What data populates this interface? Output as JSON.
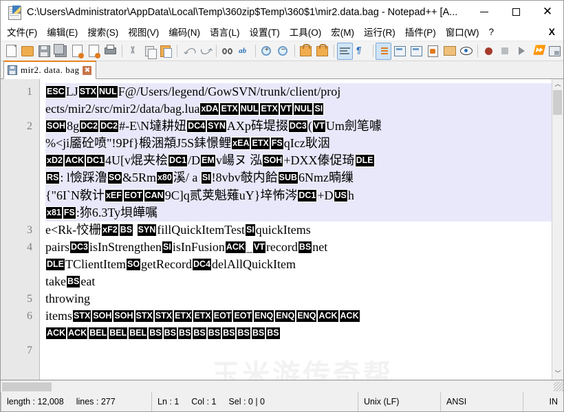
{
  "window": {
    "title": "C:\\Users\\Administrator\\AppData\\Local\\Temp\\360zip$Temp\\360$1\\mir2.data.bag - Notepad++ [A...",
    "minimize": "—",
    "maximize": "❐",
    "close": "✕"
  },
  "menu": {
    "items": [
      {
        "label": "文件(F)"
      },
      {
        "label": "编辑(E)"
      },
      {
        "label": "搜索(S)"
      },
      {
        "label": "视图(V)"
      },
      {
        "label": "编码(N)"
      },
      {
        "label": "语言(L)"
      },
      {
        "label": "设置(T)"
      },
      {
        "label": "工具(O)"
      },
      {
        "label": "宏(M)"
      },
      {
        "label": "运行(R)"
      },
      {
        "label": "插件(P)"
      },
      {
        "label": "窗口(W)"
      },
      {
        "label": "?"
      }
    ],
    "doc_close": "X"
  },
  "toolbar": {
    "buttons": [
      "new-file-icon",
      "open-file-icon",
      "save-icon",
      "save-all-icon",
      "close-file-icon",
      "close-all-files-icon",
      "print-icon",
      "cut-icon",
      "copy-icon",
      "paste-icon",
      "undo-icon",
      "redo-icon",
      "find-icon",
      "replace-icon",
      "zoom-in-icon",
      "zoom-out-icon",
      "sync-vertical-scroll-icon",
      "sync-horizontal-scroll-icon",
      "word-wrap-icon",
      "show-all-characters-icon",
      "indent-guide-icon",
      "ui-user-defined-dialog-icon",
      "show-document-map-icon",
      "function-list-icon",
      "folder-as-workspace-icon",
      "monitoring-icon",
      "start-recording-icon",
      "stop-recording-icon",
      "play-macro-icon",
      "run-macro-multiple-icon",
      "save-macro-icon"
    ]
  },
  "tab": {
    "label": "mir2. data. bag",
    "close": "✖",
    "icon": "saved-disk-icon"
  },
  "editor": {
    "watermark": "玉米游传奇帮",
    "lines": [
      {
        "number": "1",
        "highlighted": true,
        "rows": [
          [
            {
              "t": "c",
              "v": "ESC"
            },
            {
              "t": "p",
              "v": "LJ"
            },
            {
              "t": "c",
              "v": "STX"
            },
            {
              "t": "c",
              "v": "NUL"
            },
            {
              "t": "p",
              "v": "F@/Users/legend/GowSVN/trunk/client/proj"
            }
          ],
          [
            {
              "t": "p",
              "v": "ects/mir2/src/mir2/data/bag.lua"
            },
            {
              "t": "c",
              "v": "xDA"
            },
            {
              "t": "c",
              "v": "ETX"
            },
            {
              "t": "c",
              "v": "NUL"
            },
            {
              "t": "c",
              "v": "ETX"
            },
            {
              "t": "c",
              "v": "VT"
            },
            {
              "t": "c",
              "v": "NUL"
            },
            {
              "t": "c",
              "v": "SI"
            }
          ]
        ]
      },
      {
        "number": "2",
        "highlighted": true,
        "rows": [
          [
            {
              "t": "c",
              "v": "SOH"
            },
            {
              "t": "p",
              "v": "8g"
            },
            {
              "t": "c",
              "v": "DC2"
            },
            {
              "t": "c",
              "v": "DC2"
            },
            {
              "t": "p",
              "v": "#-E\\N墶耕妞"
            },
            {
              "t": "c",
              "v": "DC4"
            },
            {
              "t": "c",
              "v": "SYN"
            },
            {
              "t": "p",
              "v": "AXp砗堤掇"
            },
            {
              "t": "c",
              "v": "DC3"
            },
            {
              "t": "p",
              "v": "("
            },
            {
              "t": "c",
              "v": "VT"
            },
            {
              "t": "p",
              "v": "Um劍笔噱"
            }
          ],
          [
            {
              "t": "p",
              "v": "%<ji靥砼喷\"!9Pf}椴涃頮J5S銇憬鲤"
            },
            {
              "t": "c",
              "v": "xEA"
            },
            {
              "t": "c",
              "v": "ETX"
            },
            {
              "t": "c",
              "v": "FS"
            },
            {
              "t": "p",
              "v": "qIcz耿洇"
            }
          ],
          [
            {
              "t": "c",
              "v": "xD2"
            },
            {
              "t": "c",
              "v": "ACK"
            },
            {
              "t": "c",
              "v": "DC1"
            },
            {
              "t": "p",
              "v": "4U[v焜夹桧"
            },
            {
              "t": "c",
              "v": "DC1"
            },
            {
              "t": "p",
              "v": "/D"
            },
            {
              "t": "c",
              "v": "EM"
            },
            {
              "t": "p",
              "v": "v崵ヌ 泓"
            },
            {
              "t": "c",
              "v": "SOH"
            },
            {
              "t": "p",
              "v": "+DXX傣促琦"
            },
            {
              "t": "c",
              "v": "DLE"
            }
          ],
          [
            {
              "t": "c",
              "v": "RS"
            },
            {
              "t": "p",
              "v": ":  l憸踩澛"
            },
            {
              "t": "c",
              "v": "SO"
            },
            {
              "t": "p",
              "v": "&5Rm"
            },
            {
              "t": "c",
              "v": "x80"
            },
            {
              "t": "p",
              "v": "溪/ a "
            },
            {
              "t": "c",
              "v": "SI"
            },
            {
              "t": "p",
              "v": "!8vbv攲内餄"
            },
            {
              "t": "c",
              "v": "SUB"
            },
            {
              "t": "p",
              "v": "6Nmz暔缫"
            }
          ],
          [
            {
              "t": "p",
              "v": "{\"6I`N敎计"
            },
            {
              "t": "c",
              "v": "xEF"
            },
            {
              "t": "c",
              "v": "EOT"
            },
            {
              "t": "c",
              "v": "CAN"
            },
            {
              "t": "p",
              "v": "9C]q贰荚魁薙uY}垶怖涔"
            },
            {
              "t": "c",
              "v": "DC1"
            },
            {
              "t": "p",
              "v": "+D"
            },
            {
              "t": "c",
              "v": "US"
            },
            {
              "t": "p",
              "v": "h"
            }
          ],
          [
            {
              "t": "c",
              "v": "x81"
            },
            {
              "t": "c",
              "v": "FS"
            },
            {
              "t": "p",
              "v": ":狝6.3Ty垻皣嘱"
            }
          ]
        ]
      },
      {
        "number": "3",
        "highlighted": false,
        "rows": [
          [
            {
              "t": "p",
              "v": "e<Rk-恔栅"
            },
            {
              "t": "c",
              "v": "xF2"
            },
            {
              "t": "c",
              "v": "BS"
            },
            {
              "t": "p",
              "v": " "
            },
            {
              "t": "c",
              "v": "SYN"
            },
            {
              "t": "p",
              "v": "fillQuickItemTest"
            },
            {
              "t": "c",
              "v": "SI"
            },
            {
              "t": "p",
              "v": "quickItems"
            }
          ]
        ]
      },
      {
        "number": "4",
        "highlighted": false,
        "rows": [
          [
            {
              "t": "p",
              "v": "pairs"
            },
            {
              "t": "c",
              "v": "DC3"
            },
            {
              "t": "p",
              "v": "isInStrengthen"
            },
            {
              "t": "c",
              "v": "SI"
            },
            {
              "t": "p",
              "v": "isInFusion"
            },
            {
              "t": "c",
              "v": "ACK"
            },
            {
              "t": "p",
              "v": "_"
            },
            {
              "t": "c",
              "v": "VT"
            },
            {
              "t": "p",
              "v": "record"
            },
            {
              "t": "c",
              "v": "BS"
            },
            {
              "t": "p",
              "v": "net"
            }
          ],
          [
            {
              "t": "c",
              "v": "DLE"
            },
            {
              "t": "p",
              "v": "TClientItem"
            },
            {
              "t": "c",
              "v": "SO"
            },
            {
              "t": "p",
              "v": "getRecord"
            },
            {
              "t": "c",
              "v": "DC4"
            },
            {
              "t": "p",
              "v": "delAllQuickItem"
            }
          ],
          [
            {
              "t": "p",
              "v": "take"
            },
            {
              "t": "c",
              "v": "BS"
            },
            {
              "t": "p",
              "v": "eat"
            }
          ]
        ]
      },
      {
        "number": "5",
        "highlighted": false,
        "rows": [
          [
            {
              "t": "p",
              "v": "throwing"
            }
          ]
        ]
      },
      {
        "number": "6",
        "highlighted": false,
        "rows": [
          [
            {
              "t": "p",
              "v": "items"
            },
            {
              "t": "c",
              "v": "STX"
            },
            {
              "t": "c",
              "v": "SOH"
            },
            {
              "t": "c",
              "v": "SOH"
            },
            {
              "t": "c",
              "v": "STX"
            },
            {
              "t": "c",
              "v": "STX"
            },
            {
              "t": "c",
              "v": "ETX"
            },
            {
              "t": "c",
              "v": "ETX"
            },
            {
              "t": "c",
              "v": "EOT"
            },
            {
              "t": "c",
              "v": "EOT"
            },
            {
              "t": "c",
              "v": "ENQ"
            },
            {
              "t": "c",
              "v": "ENQ"
            },
            {
              "t": "c",
              "v": "ENQ"
            },
            {
              "t": "c",
              "v": "ACK"
            },
            {
              "t": "c",
              "v": "ACK"
            }
          ],
          [
            {
              "t": "c",
              "v": "ACK"
            },
            {
              "t": "c",
              "v": "ACK"
            },
            {
              "t": "c",
              "v": "BEL"
            },
            {
              "t": "c",
              "v": "BEL"
            },
            {
              "t": "c",
              "v": "BEL"
            },
            {
              "t": "c",
              "v": "BS"
            },
            {
              "t": "c",
              "v": "BS"
            },
            {
              "t": "c",
              "v": "BS"
            },
            {
              "t": "c",
              "v": "BS"
            },
            {
              "t": "c",
              "v": "BS"
            },
            {
              "t": "c",
              "v": "BS"
            },
            {
              "t": "c",
              "v": "BS"
            },
            {
              "t": "c",
              "v": "BS"
            },
            {
              "t": "c",
              "v": "BS"
            }
          ]
        ]
      },
      {
        "number": "7",
        "highlighted": false,
        "rows": [
          [
            {
              "t": "p",
              "v": ""
            }
          ]
        ]
      }
    ],
    "scroll_up": "︿",
    "scroll_down": "﹀"
  },
  "statusbar": {
    "length_label": "length : 12,008",
    "lines_label": "lines : 277",
    "ln": "Ln : 1",
    "col": "Col : 1",
    "sel": "Sel : 0 | 0",
    "eol": "Unix (LF)",
    "encoding": "ANSI",
    "insert": "IN"
  }
}
